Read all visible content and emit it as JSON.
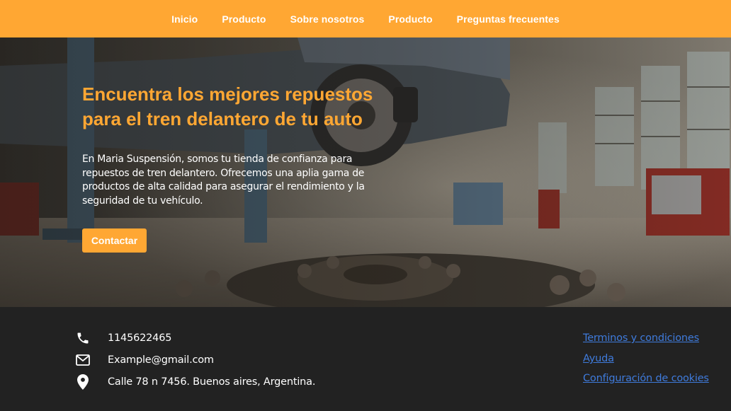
{
  "nav": {
    "items": [
      "Inicio",
      "Producto",
      "Sobre nosotros",
      "Producto",
      "Preguntas frecuentes"
    ]
  },
  "hero": {
    "title": "Encuentra los mejores repuestos para el tren delantero de tu auto",
    "description": "En Maria Suspensión, somos tu tienda de confianza para repuestos de tren delantero. Ofrecemos una aplia gama de productos de alta calidad para asegurar el rendimiento y la seguridad de tu vehículo.",
    "button_label": "Contactar",
    "background_image": "car-workshop-lift-photo"
  },
  "footer": {
    "phone": "1145622465",
    "email": "Example@gmail.com",
    "address": "Calle 78 n 7456. Buenos aires, Argentina.",
    "links": [
      "Terminos y condiciones",
      "Ayuda",
      "Configuración de cookies"
    ],
    "icons": [
      "phone-icon",
      "mail-icon",
      "location-pin-icon"
    ]
  },
  "colors": {
    "accent": "#ffa733",
    "footer_bg": "#222222",
    "link": "#3f7bdc"
  }
}
